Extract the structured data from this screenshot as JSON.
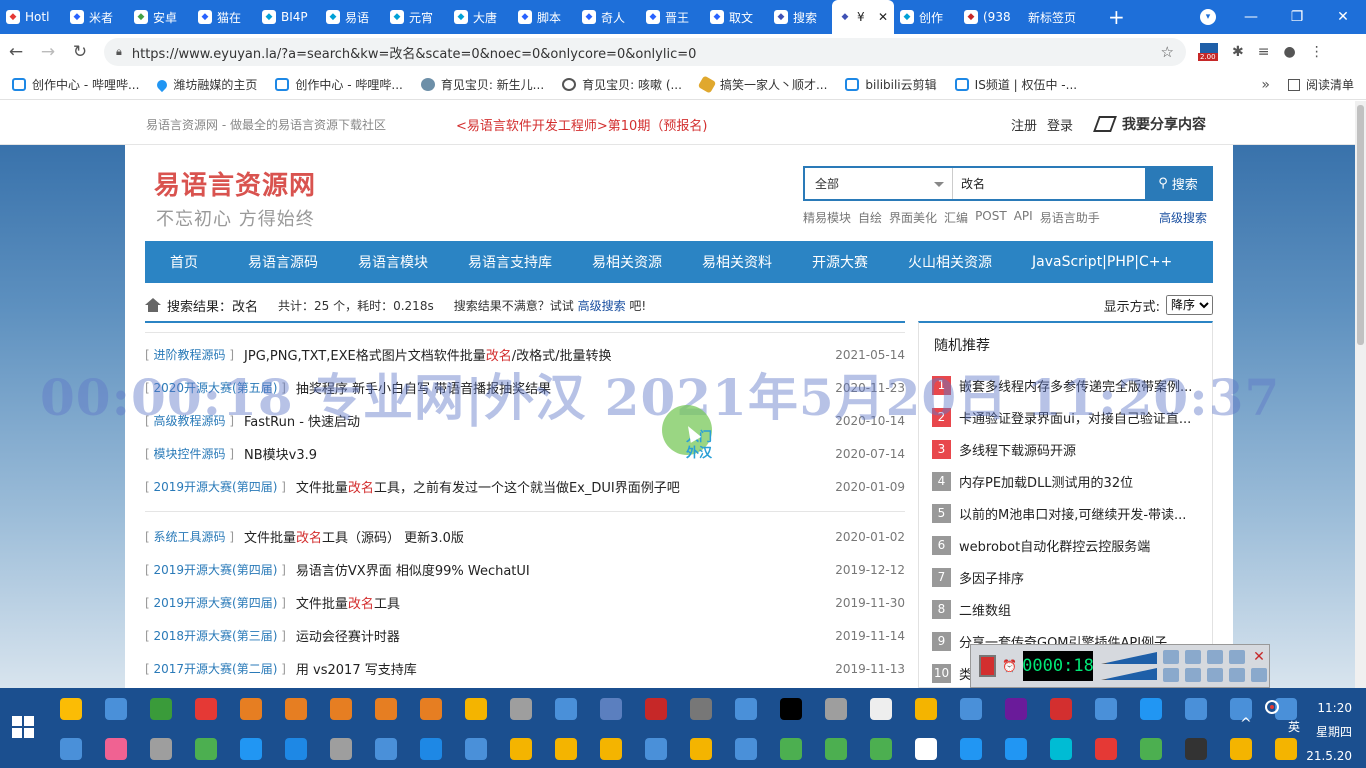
{
  "browser": {
    "tabs": [
      {
        "label": "Hotl",
        "icon": "z-icon",
        "color": "#e53935"
      },
      {
        "label": "米者",
        "icon": "paw-icon",
        "color": "#2962ff"
      },
      {
        "label": "安卓",
        "icon": "g-icon",
        "color": "#43a047"
      },
      {
        "label": "猫在",
        "icon": "paw-icon",
        "color": "#2962ff"
      },
      {
        "label": "BI4P",
        "icon": "bilibili-icon",
        "color": "#00a1d6"
      },
      {
        "label": "易语",
        "icon": "bilibili-icon",
        "color": "#00a1d6"
      },
      {
        "label": "元宵",
        "icon": "bilibili-icon",
        "color": "#00a1d6"
      },
      {
        "label": "大唐",
        "icon": "bilibili-icon",
        "color": "#00a1d6"
      },
      {
        "label": "脚本",
        "icon": "paw-icon",
        "color": "#2962ff"
      },
      {
        "label": "奇人",
        "icon": "paw-icon",
        "color": "#2962ff"
      },
      {
        "label": "晋王",
        "icon": "paw-icon",
        "color": "#2962ff"
      },
      {
        "label": "取文",
        "icon": "paw-icon",
        "color": "#2962ff"
      },
      {
        "label": "搜索",
        "icon": "site-icon",
        "color": "#3f51b5"
      }
    ],
    "active_tab": {
      "label": "¥",
      "close": "✕"
    },
    "tabs_after": [
      {
        "label": "创作",
        "icon": "bilibili-icon",
        "color": "#00a1d6"
      },
      {
        "label": "(938",
        "icon": "red-icon",
        "color": "#c62828"
      },
      {
        "label": "新标签页",
        "icon": "",
        "color": ""
      }
    ],
    "new_tab": "+",
    "window_controls": {
      "min": "—",
      "max": "❐",
      "close": "✕"
    },
    "url": "https://www.eyuyan.la/?a=search&kw=改名&scate=0&noec=0&onlycore=0&onlylic=0",
    "ext_badge": "2.00",
    "bookmarks": [
      {
        "label": "创作中心 - 哔哩哔...",
        "icon": "bilibili-icon"
      },
      {
        "label": "潍坊融媒的主页",
        "icon": "pin-icon"
      },
      {
        "label": "创作中心 - 哔哩哔...",
        "icon": "bilibili-icon"
      },
      {
        "label": "育见宝贝: 新生儿...",
        "icon": "dog-icon"
      },
      {
        "label": "育见宝贝: 咳嗽 (...",
        "icon": "globe-icon"
      },
      {
        "label": "搞笑一家人丶顺才...",
        "icon": "fun-icon"
      },
      {
        "label": "bilibili云剪辑",
        "icon": "bilibili-icon"
      },
      {
        "label": "IS频道 | 权伍中 -...",
        "icon": "bilibili-icon"
      }
    ],
    "bookmarks_more": "»",
    "reading_list": "阅读清单"
  },
  "site": {
    "slogan": "易语言资源网 - 做最全的易语言资源下载社区",
    "promo": "<易语言软件开发工程师>第10期（预报名)",
    "register": "注册",
    "login": "登录",
    "share": "我要分享内容",
    "logo_title": "易语言资源网",
    "logo_sub": "不忘初心 方得始终",
    "search": {
      "scope": "全部",
      "keyword": "改名",
      "button": "搜索",
      "hotwords": [
        "精易模块",
        "自绘",
        "界面美化",
        "汇编",
        "POST",
        "API",
        "易语言助手"
      ],
      "advanced": "高级搜索"
    },
    "nav": [
      "首页",
      "易语言源码",
      "易语言模块",
      "易语言支持库",
      "易相关资源",
      "易相关资料",
      "开源大赛",
      "火山相关资源",
      "JavaScript|PHP|C++"
    ],
    "result_bar": {
      "label": "搜索结果：改名",
      "stat": "共计：25 个，耗时：0.218s",
      "hint_prefix": "搜索结果不满意？试试",
      "hint_link": "高级搜索",
      "hint_suffix": "吧!",
      "display_label": "显示方式:",
      "display_value": "降序"
    },
    "results": [
      [
        {
          "cat": "进阶教程源码",
          "pre": "JPG,PNG,TXT,EXE格式图片文档软件批量",
          "hl": "改名",
          "post": "/改格式/批量转换",
          "date": "2021-05-14"
        },
        {
          "cat": "2020开源大赛(第五届)",
          "pre": "抽奖程序 新手小白自写 带语音播报抽奖结果",
          "hl": "",
          "post": "",
          "date": "2020-11-23"
        },
        {
          "cat": "高级教程源码",
          "pre": "FastRun - 快速启动",
          "hl": "",
          "post": "",
          "date": "2020-10-14"
        },
        {
          "cat": "模块控件源码",
          "pre": "NB模块v3.9",
          "hl": "",
          "post": "",
          "date": "2020-07-14"
        },
        {
          "cat": "2019开源大赛(第四届)",
          "pre": "文件批量",
          "hl": "改名",
          "post": "工具，之前有发过一个这个就当做Ex_DUI界面例子吧",
          "date": "2020-01-09"
        }
      ],
      [
        {
          "cat": "系统工具源码",
          "pre": "文件批量",
          "hl": "改名",
          "post": "工具（源码） 更新3.0版",
          "date": "2020-01-02"
        },
        {
          "cat": "2019开源大赛(第四届)",
          "pre": "易语言仿VX界面 相似度99% WechatUI",
          "hl": "",
          "post": "",
          "date": "2019-12-12"
        },
        {
          "cat": "2019开源大赛(第四届)",
          "pre": "文件批量",
          "hl": "改名",
          "post": "工具",
          "date": "2019-11-30"
        },
        {
          "cat": "2018开源大赛(第三届)",
          "pre": "运动会径赛计时器",
          "hl": "",
          "post": "",
          "date": "2019-11-14"
        },
        {
          "cat": "2017开源大赛(第二届)",
          "pre": "用 vs2017 写支持库",
          "hl": "",
          "post": "",
          "date": "2019-11-13"
        }
      ]
    ],
    "sidebar": {
      "title": "随机推荐",
      "items": [
        {
          "n": "1",
          "text": "嵌套多线程内存多参传递完全版带案例...",
          "hot": true
        },
        {
          "n": "2",
          "text": "卡通验证登录界面ui，对接自己验证直...",
          "hot": true
        },
        {
          "n": "3",
          "text": "多线程下载源码开源",
          "hot": true
        },
        {
          "n": "4",
          "text": "内存PE加载DLL测试用的32位",
          "hot": false
        },
        {
          "n": "5",
          "text": "以前的M池串口对接,可继续开发-带读...",
          "hot": false
        },
        {
          "n": "6",
          "text": "webrobot自动化群控云控服务端",
          "hot": false
        },
        {
          "n": "7",
          "text": "多因子排序",
          "hot": false
        },
        {
          "n": "8",
          "text": "二维数组",
          "hot": false
        },
        {
          "n": "9",
          "text": "分享一套传奇GOM引擎插件API例子",
          "hot": false
        },
        {
          "n": "10",
          "text": "类",
          "hot": false
        }
      ]
    }
  },
  "overlay": {
    "watermark": "00:00:18 专业网|外汉 2021年5月20日 11:20:37",
    "floating_text_1": "入门",
    "floating_text_2": "外汉",
    "recorder_time": "0000:18"
  },
  "taskbar": {
    "time": "11:20",
    "weekday": "星期四",
    "date": "21.5.20",
    "ime": "英",
    "tray_arrow": "^",
    "row1_colors": [
      "#fbbc05",
      "#4a90d9",
      "#3a9b3a",
      "#e53935",
      "#e67e22",
      "#e67e22",
      "#e67e22",
      "#e67e22",
      "#e67e22",
      "#f4b400",
      "#9e9e9e",
      "#4a90d9",
      "#5b7fbf",
      "#c62828",
      "#777",
      "#4a90d9",
      "#000",
      "#9e9e9e",
      "#eee",
      "#f4b400",
      "#4a90d9",
      "#6a1b9a",
      "#d32f2f",
      "#4a90d9",
      "#2196f3",
      "#4a90d9",
      "#4a90d9",
      "#4a90d9"
    ],
    "row2_colors": [
      "#4a90d9",
      "#f06292",
      "#9e9e9e",
      "#4caf50",
      "#2196f3",
      "#1e88e5",
      "#9e9e9e",
      "#4a90d9",
      "#1e88e5",
      "#4a90d9",
      "#f4b400",
      "#f4b400",
      "#f4b400",
      "#4a90d9",
      "#f4b400",
      "#4a90d9",
      "#4caf50",
      "#4caf50",
      "#4caf50",
      "#fff",
      "#2196f3",
      "#2196f3",
      "#00bcd4",
      "#e53935",
      "#4caf50",
      "#333",
      "#f4b400",
      "#f4b400"
    ]
  }
}
